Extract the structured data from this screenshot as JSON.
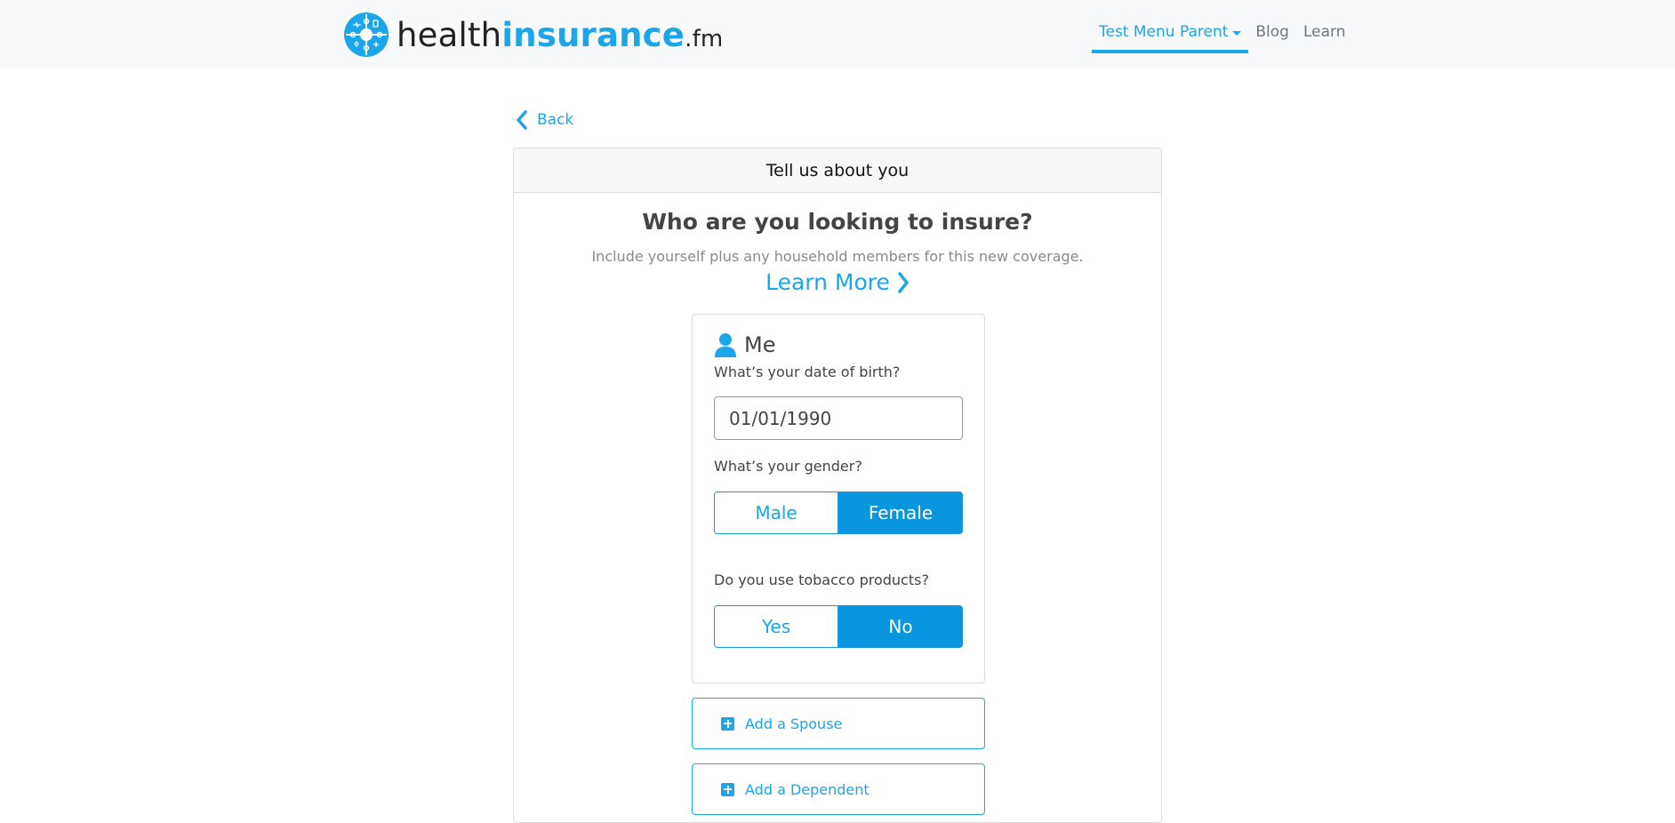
{
  "brand": {
    "name_part1": "health",
    "name_part2": "insurance",
    "name_part3": ".fm",
    "accent": "#1aa6e8"
  },
  "nav": {
    "items": [
      {
        "label": "Test Menu Parent",
        "active": true,
        "dropdown": true
      },
      {
        "label": "Blog"
      },
      {
        "label": "Learn"
      }
    ]
  },
  "back": {
    "label": "Back",
    "icon": "chevron-left-icon"
  },
  "card": {
    "header": "Tell us about you",
    "question": "Who are you looking to insure?",
    "subtext": "Include yourself plus any household members for this new coverage.",
    "learn_more": "Learn More"
  },
  "me": {
    "title": "Me",
    "icon": "person-icon",
    "dob_label": "What’s your date of birth?",
    "dob_value": "01/01/1990",
    "gender_label": "What’s your gender?",
    "gender_options": [
      "Male",
      "Female"
    ],
    "gender_selected": "Female",
    "tobacco_label": "Do you use tobacco products?",
    "tobacco_options": [
      "Yes",
      "No"
    ],
    "tobacco_selected": "No"
  },
  "add_spouse": {
    "label": "Add a Spouse",
    "icon": "plus-square-icon"
  },
  "add_dependent": {
    "label": "Add a Dependent",
    "icon": "plus-square-icon"
  }
}
